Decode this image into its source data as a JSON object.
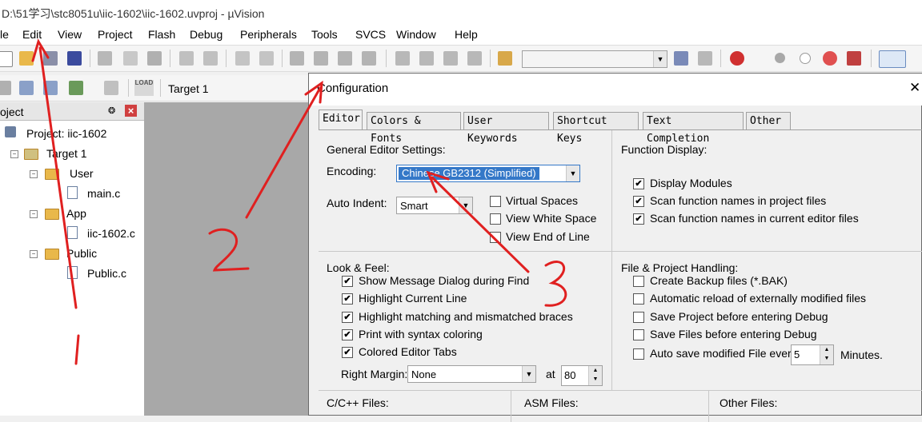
{
  "window": {
    "title": "D:\\51学习\\stc8051u\\iic-1602\\iic-1602.uvproj - µVision"
  },
  "menu": [
    "le",
    "Edit",
    "View",
    "Project",
    "Flash",
    "Debug",
    "Peripherals",
    "Tools",
    "SVCS",
    "Window",
    "Help"
  ],
  "toolbar2": {
    "load_label": "LOAD",
    "target": "Target 1"
  },
  "project_pane": {
    "title": "oject",
    "pin": "❂",
    "close": "×",
    "tree": {
      "project": "Project: iic-1602",
      "target": "Target 1",
      "groups": [
        {
          "name": "User",
          "file": "main.c"
        },
        {
          "name": "App",
          "file": "iic-1602.c"
        },
        {
          "name": "Public",
          "file": "Public.c"
        }
      ]
    }
  },
  "dialog": {
    "title": "Configuration",
    "close": "✕",
    "tabs": [
      "Editor",
      "Colors & Fonts",
      "User Keywords",
      "Shortcut Keys",
      "Text Completion",
      "Other"
    ],
    "general": {
      "heading": "General Editor Settings:",
      "encoding_label": "Encoding:",
      "encoding_value": "Chinese GB2312 (Simplified)",
      "auto_indent_label": "Auto Indent:",
      "auto_indent_value": "Smart",
      "virtual_spaces": "Virtual Spaces",
      "view_white_space": "View White Space",
      "view_end_of_line": "View End of Line"
    },
    "function_display": {
      "heading": "Function Display:",
      "display_modules": "Display Modules",
      "scan_project": "Scan function names in project files",
      "scan_editor": "Scan function names in current editor files"
    },
    "look_feel": {
      "heading": "Look & Feel:",
      "items": [
        "Show Message Dialog during Find",
        "Highlight Current Line",
        "Highlight matching and mismatched braces",
        "Print with syntax coloring",
        "Colored Editor Tabs"
      ],
      "right_margin_label": "Right Margin:",
      "right_margin_value": "None",
      "at_label": "at",
      "at_value": "80"
    },
    "file_project": {
      "heading": "File & Project Handling:",
      "items": [
        "Create Backup files (*.BAK)",
        "Automatic reload of externally modified files",
        "Save Project before entering Debug",
        "Save Files before entering Debug"
      ],
      "autosave_label": "Auto save modified File every",
      "autosave_value": "5",
      "minutes_label": "Minutes."
    },
    "bottom": {
      "c_files": "C/C++ Files:",
      "asm_files": "ASM Files:",
      "other_files": "Other Files:"
    }
  },
  "check": "✔"
}
